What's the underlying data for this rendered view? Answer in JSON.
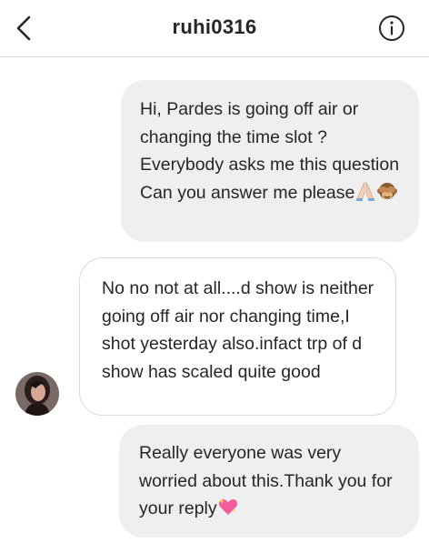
{
  "header": {
    "username": "ruhi0316"
  },
  "messages": [
    {
      "sender": "me",
      "text": "Hi, Pardes is going off air or changing the time slot ? Everybody asks me this question Can you answer me please",
      "emojis": [
        "folded-hands-emoji",
        "see-no-evil-monkey-emoji"
      ]
    },
    {
      "sender": "ruhi0316",
      "text": "No no not at all....d show is neither going off air nor changing time,I shot yesterday also.infact trp of d show has scaled quite good"
    },
    {
      "sender": "me",
      "text": "Really everyone was very worried about this.Thank you for your reply",
      "emojis": [
        "sparkling-heart-emoji"
      ]
    }
  ],
  "colors": {
    "sent_bubble": "#efefef",
    "received_border": "#dbdbdb",
    "text": "#262626"
  }
}
